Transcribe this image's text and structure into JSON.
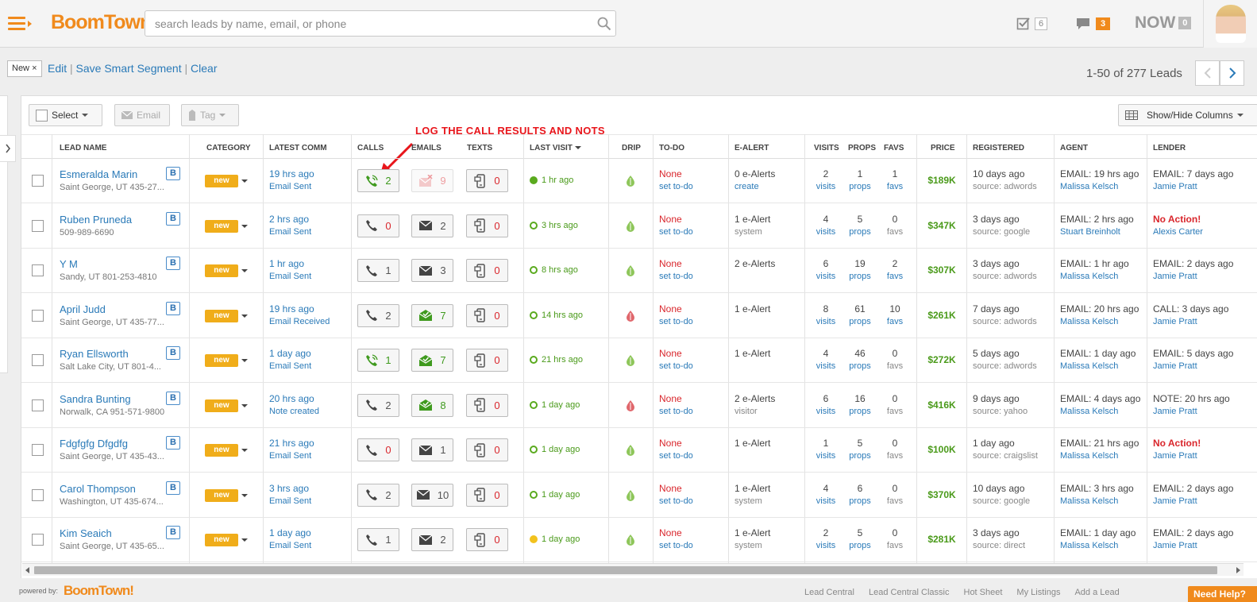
{
  "header": {
    "logo": "BoomTown!",
    "search_placeholder": "search leads by name, email, or phone",
    "tasks_count": "6",
    "messages_count": "3",
    "now_label": "NOW",
    "now_count": "0"
  },
  "segment": {
    "chip_label": "New",
    "chip_close": "×",
    "edit": "Edit",
    "save": "Save Smart Segment",
    "clear": "Clear",
    "sep": "|",
    "lead_count": "1-50 of 277 Leads"
  },
  "toolbar": {
    "select": "Select",
    "email": "Email",
    "tag": "Tag",
    "show_hide": "Show/Hide Columns"
  },
  "annotation": "LOG THE CALL RESULTS AND NOTS",
  "columns": [
    "LEAD NAME",
    "CATEGORY",
    "LATEST COMM",
    "CALLS",
    "EMAILS",
    "TEXTS",
    "LAST VISIT",
    "DRIP",
    "TO-DO",
    "E-ALERT",
    "VISITS",
    "PROPS",
    "FAVS",
    "PRICE",
    "REGISTERED",
    "AGENT",
    "LENDER"
  ],
  "labels": {
    "visits": "visits",
    "props": "props",
    "favs": "favs"
  },
  "rows": [
    {
      "name": "Esmeralda Marin",
      "sub": "Saint George, UT  435-27...",
      "badge": "B",
      "category": "new",
      "comm": "19 hrs ago",
      "comm_type": "Email Sent",
      "calls": "2",
      "emails": "9",
      "texts": "0",
      "last_visit": "1 hr ago",
      "todo": "None",
      "todo_link": "set to-do",
      "ealert": "0 e-Alerts",
      "ealert_sub": "create",
      "visits": "2",
      "props": "1",
      "favs": "1",
      "price": "$189K",
      "registered": "10 days ago",
      "source": "source: adwords",
      "agent_last": "EMAIL: 19 hrs ago",
      "agent": "Malissa Kelsch",
      "lender_last": "EMAIL: 7 days ago",
      "lender": "Jamie Pratt"
    },
    {
      "name": "Ruben Pruneda",
      "sub": "509-989-6690",
      "badge": "B",
      "category": "new",
      "comm": "2 hrs ago",
      "comm_type": "Email Sent",
      "calls": "0",
      "emails": "2",
      "texts": "0",
      "last_visit": "3 hrs ago",
      "todo": "None",
      "todo_link": "set to-do",
      "ealert": "1 e-Alert",
      "ealert_sub": "system",
      "visits": "4",
      "props": "5",
      "favs": "0",
      "price": "$347K",
      "registered": "3 days ago",
      "source": "source: google",
      "agent_last": "EMAIL: 2 hrs ago",
      "agent": "Stuart Breinholt",
      "lender_last": "No Action!",
      "lender": "Alexis Carter"
    },
    {
      "name": "Y M",
      "sub": "Sandy, UT  801-253-4810",
      "badge": "B",
      "category": "new",
      "comm": "1 hr ago",
      "comm_type": "Email Sent",
      "calls": "1",
      "emails": "3",
      "texts": "0",
      "last_visit": "8 hrs ago",
      "todo": "None",
      "todo_link": "set to-do",
      "ealert": "2 e-Alerts",
      "ealert_sub": "",
      "visits": "6",
      "props": "19",
      "favs": "2",
      "price": "$307K",
      "registered": "3 days ago",
      "source": "source: adwords",
      "agent_last": "EMAIL: 1 hr ago",
      "agent": "Malissa Kelsch",
      "lender_last": "EMAIL: 2 days ago",
      "lender": "Jamie Pratt"
    },
    {
      "name": "April Judd",
      "sub": "Saint George, UT  435-77...",
      "badge": "B",
      "category": "new",
      "comm": "19 hrs ago",
      "comm_type": "Email Received",
      "calls": "2",
      "emails": "7",
      "texts": "0",
      "last_visit": "14 hrs ago",
      "todo": "None",
      "todo_link": "set to-do",
      "ealert": "1 e-Alert",
      "ealert_sub": "",
      "visits": "8",
      "props": "61",
      "favs": "10",
      "price": "$261K",
      "registered": "7 days ago",
      "source": "source: adwords",
      "agent_last": "EMAIL: 20 hrs ago",
      "agent": "Malissa Kelsch",
      "lender_last": "CALL: 3 days ago",
      "lender": "Jamie Pratt"
    },
    {
      "name": "Ryan Ellsworth",
      "sub": "Salt Lake City, UT  801-4...",
      "badge": "B",
      "category": "new",
      "comm": "1 day ago",
      "comm_type": "Email Sent",
      "calls": "1",
      "emails": "7",
      "texts": "0",
      "last_visit": "21 hrs ago",
      "todo": "None",
      "todo_link": "set to-do",
      "ealert": "1 e-Alert",
      "ealert_sub": "",
      "visits": "4",
      "props": "46",
      "favs": "0",
      "price": "$272K",
      "registered": "5 days ago",
      "source": "source: adwords",
      "agent_last": "EMAIL: 1 day ago",
      "agent": "Malissa Kelsch",
      "lender_last": "EMAIL: 5 days ago",
      "lender": "Jamie Pratt"
    },
    {
      "name": "Sandra Bunting",
      "sub": "Norwalk, CA  951-571-9800",
      "badge": "B",
      "category": "new",
      "comm": "20 hrs ago",
      "comm_type": "Note created",
      "calls": "2",
      "emails": "8",
      "texts": "0",
      "last_visit": "1 day ago",
      "todo": "None",
      "todo_link": "set to-do",
      "ealert": "2 e-Alerts",
      "ealert_sub": "visitor",
      "visits": "6",
      "props": "16",
      "favs": "0",
      "price": "$416K",
      "registered": "9 days ago",
      "source": "source: yahoo",
      "agent_last": "EMAIL: 4 days ago",
      "agent": "Malissa Kelsch",
      "lender_last": "NOTE: 20 hrs ago",
      "lender": "Jamie Pratt"
    },
    {
      "name": "Fdgfgfg Dfgdfg",
      "sub": "Saint George, UT  435-43...",
      "badge": "B",
      "category": "new",
      "comm": "21 hrs ago",
      "comm_type": "Email Sent",
      "calls": "0",
      "emails": "1",
      "texts": "0",
      "last_visit": "1 day ago",
      "todo": "None",
      "todo_link": "set to-do",
      "ealert": "1 e-Alert",
      "ealert_sub": "",
      "visits": "1",
      "props": "5",
      "favs": "0",
      "price": "$100K",
      "registered": "1 day ago",
      "source": "source: craigslist",
      "agent_last": "EMAIL: 21 hrs ago",
      "agent": "Malissa Kelsch",
      "lender_last": "No Action!",
      "lender": "Jamie Pratt"
    },
    {
      "name": "Carol Thompson",
      "sub": "Washington, UT  435-674...",
      "badge": "B",
      "category": "new",
      "comm": "3 hrs ago",
      "comm_type": "Email Sent",
      "calls": "2",
      "emails": "10",
      "texts": "0",
      "last_visit": "1 day ago",
      "todo": "None",
      "todo_link": "set to-do",
      "ealert": "1 e-Alert",
      "ealert_sub": "system",
      "visits": "4",
      "props": "6",
      "favs": "0",
      "price": "$370K",
      "registered": "10 days ago",
      "source": "source: google",
      "agent_last": "EMAIL: 3 hrs ago",
      "agent": "Malissa Kelsch",
      "lender_last": "EMAIL: 2 days ago",
      "lender": "Jamie Pratt"
    },
    {
      "name": "Kim Seaich",
      "sub": "Saint George, UT  435-65...",
      "badge": "B",
      "category": "new",
      "comm": "1 day ago",
      "comm_type": "Email Sent",
      "calls": "1",
      "emails": "2",
      "texts": "0",
      "last_visit": "1 day ago",
      "todo": "None",
      "todo_link": "set to-do",
      "ealert": "1 e-Alert",
      "ealert_sub": "system",
      "visits": "2",
      "props": "5",
      "favs": "0",
      "price": "$281K",
      "registered": "3 days ago",
      "source": "source: direct",
      "agent_last": "EMAIL: 1 day ago",
      "agent": "Malissa Kelsch",
      "lender_last": "EMAIL: 2 days ago",
      "lender": "Jamie Pratt"
    }
  ],
  "footer": {
    "powered": "powered by:",
    "logo": "BoomTown!",
    "links": [
      "Lead Central",
      "Lead Central Classic",
      "Hot Sheet",
      "My Listings",
      "Add a Lead"
    ],
    "help": "Need Help?"
  },
  "colors": {
    "brand": "#f08a1c",
    "link": "#2a7ab8",
    "alert": "#d9262c",
    "positive": "#4a9a1a",
    "category": "#f0ad1a"
  }
}
